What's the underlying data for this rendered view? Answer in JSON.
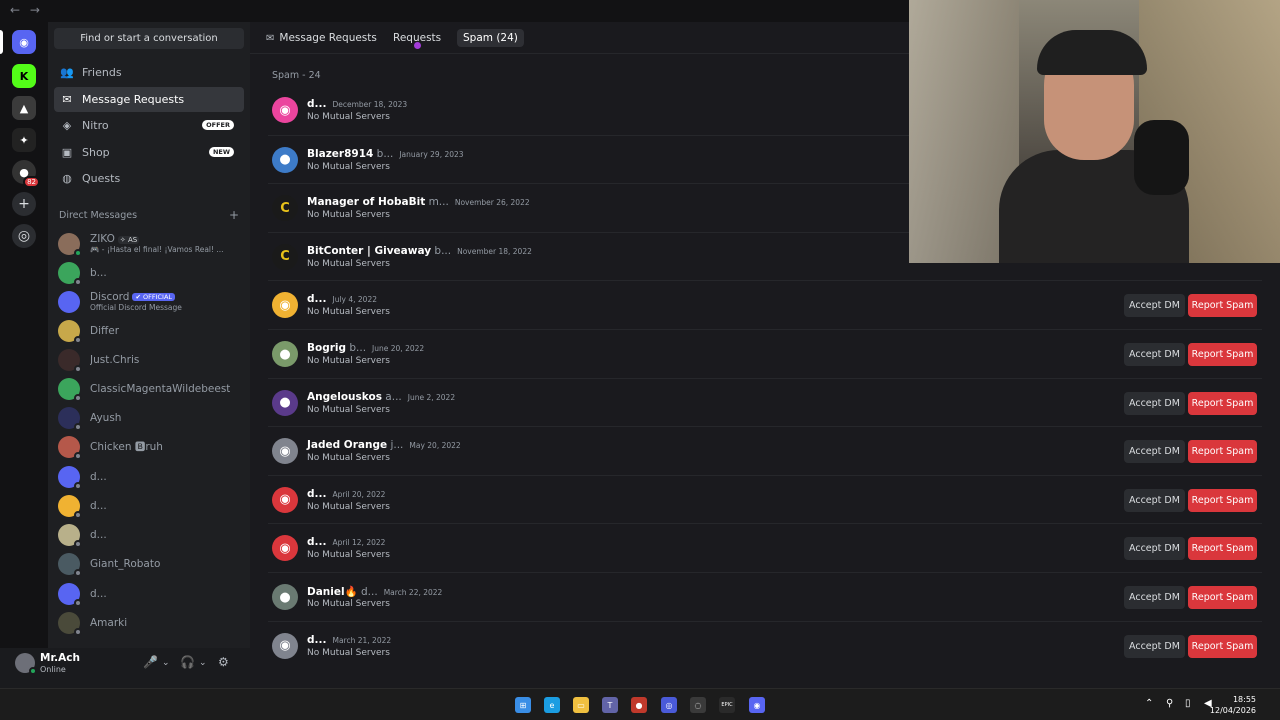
{
  "titlebar": {
    "back": "←",
    "forward": "→"
  },
  "rail": {
    "servers": [
      {
        "name": "home",
        "glyph": "◉",
        "color": "#5865f2"
      },
      {
        "name": "kick",
        "glyph": "K",
        "color": "#53fc18"
      },
      {
        "name": "server-2",
        "glyph": "▲",
        "color": "#3b3b3b"
      },
      {
        "name": "server-3",
        "glyph": "✦",
        "color": "#222"
      },
      {
        "name": "server-4",
        "glyph": "●",
        "color": "#333",
        "badge": "82"
      }
    ],
    "add_glyph": "+",
    "explore_glyph": "◎"
  },
  "sidebar": {
    "search_label": "Find or start a conversation",
    "nav": [
      {
        "label": "Friends",
        "icon": "👥"
      },
      {
        "label": "Message Requests",
        "icon": "✉"
      },
      {
        "label": "Nitro",
        "icon": "◈",
        "tag": "OFFER"
      },
      {
        "label": "Shop",
        "icon": "▣",
        "tag": "NEW"
      },
      {
        "label": "Quests",
        "icon": "◍"
      }
    ],
    "dm_header": "Direct Messages",
    "dm_plus": "+",
    "dms": [
      {
        "name": "ZIKO",
        "tag": "✧ AS",
        "sub": "🎮 - ¡Hasta el final! ¡Vamos Real! ...",
        "color": "#8a6d5b",
        "status": "on"
      },
      {
        "name": "b...",
        "color": "#3ba55c",
        "status": "off"
      },
      {
        "name": "Discord",
        "badge": "✔ OFFICIAL",
        "sub": "Official Discord Message",
        "color": "#5865f2",
        "status": "none"
      },
      {
        "name": "Differ",
        "color": "#c7a84a",
        "status": "off"
      },
      {
        "name": "Just.Chris",
        "color": "#3a2a2a",
        "status": "off"
      },
      {
        "name": "ClassicMagentaWildebeest",
        "color": "#3ba55c",
        "status": "off"
      },
      {
        "name": "Ayush",
        "color": "#2c2f5a",
        "status": "off"
      },
      {
        "name": "Chicken 🅱ruh",
        "color": "#b5584a",
        "status": "off"
      },
      {
        "name": "d...",
        "color": "#5865f2",
        "status": "off"
      },
      {
        "name": "d...",
        "color": "#f0b232",
        "status": "off"
      },
      {
        "name": "d...",
        "color": "#b8b08a",
        "status": "off"
      },
      {
        "name": "Giant_Robato",
        "color": "#4a5a62",
        "status": "off"
      },
      {
        "name": "d...",
        "color": "#5865f2",
        "status": "off"
      },
      {
        "name": "Amarki",
        "color": "#4a4a3a",
        "status": "off"
      }
    ]
  },
  "user": {
    "name": "Mr.Ach",
    "status": "Online",
    "mic": "🎤",
    "headset": "🎧",
    "settings": "⚙",
    "chev": "⌄"
  },
  "topbar": {
    "title": "Message Requests",
    "requests": "Requests",
    "spam": "Spam (24)"
  },
  "main": {
    "section": "Spam - 24",
    "accept_label": "Accept DM",
    "report_label": "Report Spam",
    "rows": [
      {
        "name": "d...",
        "tail": "",
        "date": "December 18, 2023",
        "sub": "No Mutual Servers",
        "color": "#eb459e",
        "glyph": "◉"
      },
      {
        "name": "Blazer8914",
        "tail": " b...",
        "date": "January 29, 2023",
        "sub": "No Mutual Servers",
        "color": "#3d7bc8",
        "glyph": "●"
      },
      {
        "name": "Manager of HobaBit",
        "tail": " m...",
        "date": "November 26, 2022",
        "sub": "No Mutual Servers",
        "color": "#1a1a1a",
        "glyph": "C"
      },
      {
        "name": "BitConter | Giveaway",
        "tail": " b...",
        "date": "November 18, 2022",
        "sub": "No Mutual Servers",
        "color": "#1a1a1a",
        "glyph": "C"
      },
      {
        "name": "d...",
        "tail": "",
        "date": "July 4, 2022",
        "sub": "No Mutual Servers",
        "color": "#f0b232",
        "glyph": "◉"
      },
      {
        "name": "Bogrig",
        "tail": " b...",
        "date": "June 20, 2022",
        "sub": "No Mutual Servers",
        "color": "#7a9a6a",
        "glyph": "●"
      },
      {
        "name": "Angelouskos",
        "tail": " a...",
        "date": "June 2, 2022",
        "sub": "No Mutual Servers",
        "color": "#5a3a8a",
        "glyph": "●"
      },
      {
        "name": "Jaded Orange",
        "tail": " j...",
        "date": "May 20, 2022",
        "sub": "No Mutual Servers",
        "color": "#80848e",
        "glyph": "◉"
      },
      {
        "name": "d...",
        "tail": "",
        "date": "April 20, 2022",
        "sub": "No Mutual Servers",
        "color": "#da373c",
        "glyph": "◉"
      },
      {
        "name": "d...",
        "tail": "",
        "date": "April 12, 2022",
        "sub": "No Mutual Servers",
        "color": "#da373c",
        "glyph": "◉"
      },
      {
        "name": "Daniel🔥",
        "tail": " d...",
        "date": "March 22, 2022",
        "sub": "No Mutual Servers",
        "color": "#6a7a72",
        "glyph": "●"
      },
      {
        "name": "d...",
        "tail": "",
        "date": "March 21, 2022",
        "sub": "No Mutual Servers",
        "color": "#80848e",
        "glyph": "◉"
      }
    ]
  },
  "taskbar": {
    "apps": [
      {
        "name": "windows-start",
        "glyph": "⊞",
        "color": "#3a8ee6"
      },
      {
        "name": "edge",
        "glyph": "e",
        "color": "#1b9de2"
      },
      {
        "name": "file-explorer",
        "glyph": "▭",
        "color": "#f0c040"
      },
      {
        "name": "teams",
        "glyph": "T",
        "color": "#6264a7"
      },
      {
        "name": "app-red",
        "glyph": "●",
        "color": "#c0392b"
      },
      {
        "name": "app-blue",
        "glyph": "◎",
        "color": "#4a5ad8"
      },
      {
        "name": "app-ring",
        "glyph": "◌",
        "color": "#3a3a3a"
      },
      {
        "name": "epic-games",
        "glyph": "EPIC",
        "color": "#2a2a2a"
      },
      {
        "name": "discord",
        "glyph": "◉",
        "color": "#5865f2"
      }
    ],
    "time": "18:55",
    "date": "12/04/2026",
    "tray_up": "⌃"
  }
}
